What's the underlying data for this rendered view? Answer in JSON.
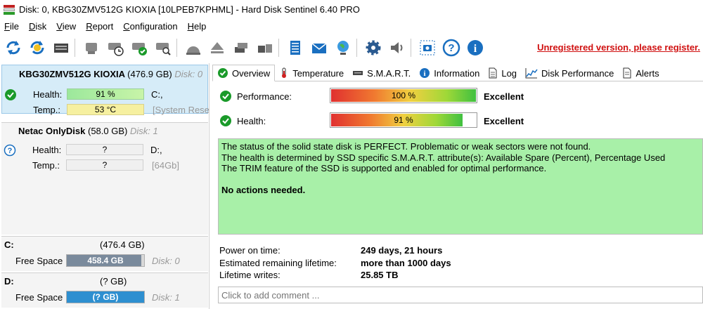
{
  "window": {
    "title": "Disk: 0, KBG30ZMV512G KIOXIA [10LPEB7KPHML]  -  Hard Disk Sentinel 6.40 PRO"
  },
  "menu": [
    {
      "label": "File",
      "accel": "F",
      "rest": "ile"
    },
    {
      "label": "Disk",
      "accel": "D",
      "rest": "isk"
    },
    {
      "label": "View",
      "accel": "V",
      "rest": "iew"
    },
    {
      "label": "Report",
      "accel": "R",
      "rest": "eport"
    },
    {
      "label": "Configuration",
      "accel": "C",
      "rest": "onfiguration"
    },
    {
      "label": "Help",
      "accel": "H",
      "rest": "elp"
    }
  ],
  "toolbar": {
    "unregistered_text": "Unregistered version, please register."
  },
  "disks": [
    {
      "name": "KBG30ZMV512G KIOXIA",
      "size": "(476.9 GB)",
      "disk_label": "Disk: 0",
      "health_label": "Health:",
      "health_value": "91 %",
      "temp_label": "Temp.:",
      "temp_value": "53 °C",
      "drive_letter": "C:,",
      "system_label": "[System Rese"
    },
    {
      "name": "Netac  OnlyDisk",
      "size": "(58.0 GB)",
      "disk_label": "Disk: 1",
      "health_label": "Health:",
      "health_value": "?",
      "temp_label": "Temp.:",
      "temp_value": "?",
      "drive_letter": "D:,",
      "system_label": "[64Gb]"
    }
  ],
  "volumes": [
    {
      "letter": "C:",
      "size": "(476.4 GB)",
      "free_label": "Free Space",
      "free_value": "458.4 GB",
      "disk_label": "Disk: 0",
      "fill_color": "#7a8a9c",
      "free_fraction": 0.96
    },
    {
      "letter": "D:",
      "size": "(? GB)",
      "free_label": "Free Space",
      "free_value": "(? GB)",
      "disk_label": "Disk: 1",
      "fill_color": "#2e8fd0",
      "free_fraction": 1.0
    }
  ],
  "tabs": [
    {
      "label": "Overview",
      "icon": "check-icon"
    },
    {
      "label": "Temperature",
      "icon": "thermometer-icon"
    },
    {
      "label": "S.M.A.R.T.",
      "icon": "smart-icon"
    },
    {
      "label": "Information",
      "icon": "info-icon"
    },
    {
      "label": "Log",
      "icon": "log-icon"
    },
    {
      "label": "Disk Performance",
      "icon": "performance-icon"
    },
    {
      "label": "Alerts",
      "icon": "alerts-icon"
    }
  ],
  "overview": {
    "performance_label": "Performance:",
    "performance_value": "100 %",
    "performance_fraction": 1.0,
    "performance_verdict": "Excellent",
    "health_label": "Health:",
    "health_value": "91 %",
    "health_fraction": 0.91,
    "health_verdict": "Excellent",
    "status_lines": [
      "The status of the solid state disk is PERFECT. Problematic or weak sectors were not found.",
      "The health is determined by SSD specific S.M.A.R.T. attribute(s):  Available Spare (Percent), Percentage Used",
      "The TRIM feature of the SSD is supported and enabled for optimal performance."
    ],
    "action_text": "No actions needed.",
    "power_on_label": "Power on time:",
    "power_on_value": "249 days, 21 hours",
    "remaining_label": "Estimated remaining lifetime:",
    "remaining_value": "more than 1000 days",
    "writes_label": "Lifetime writes:",
    "writes_value": "25.85 TB",
    "comment_placeholder": "Click to add comment ..."
  },
  "colors": {
    "accent_green": "#a8f0a8",
    "selected_disk": "#d6ecf8",
    "unregistered": "#d01010"
  }
}
